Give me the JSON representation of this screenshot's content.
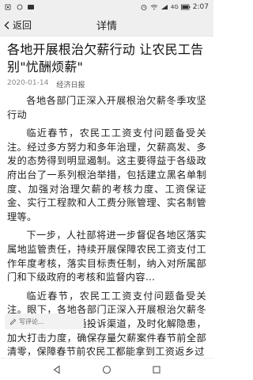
{
  "status_bar": {
    "time": "2:07",
    "signal_text": "4G"
  },
  "navbar": {
    "back_label": "返回",
    "title": "详情"
  },
  "article": {
    "headline": "各地开展根治欠薪行动 让农民工告别\"忧酬烦薪\"",
    "date": "2020-01-14",
    "source": "经济日报",
    "paragraphs": [
      "各地各部门正深入开展根治欠薪冬季攻坚行动",
      "临近春节，农民工工资支付问题备受关注。经过多方努力和多年治理，欠薪高发、多发的态势得到明显遏制。这主要得益于各级政府出台了一系列根治举措，包括建立黑名单制度、加强对治理欠薪的考核力度、工资保证金、实行工程款和人工费分账管理、实名制管理等。",
      "下一步，人社部将进一步督促各地区落实属地监管责任，持续开展保障农民工资支付工作年度考核，落实目标责任制，纳入对所属部门和下级政府的考核和监督内容…",
      "临近春节，农民工工资支付问题备受关注。眼下，各地各部门正深入开展根治欠薪冬季攻坚行动，畅通投诉渠道，及时化解隐患，加大打击力度，确保存量欠薪案件春节前全部清零，保障春节前农民工都能拿到工资返乡过"
    ]
  },
  "comment": {
    "placeholder": "写评论..."
  },
  "colors": {
    "bar_bg": "#efefef",
    "text": "#222222",
    "meta": "#888888"
  }
}
